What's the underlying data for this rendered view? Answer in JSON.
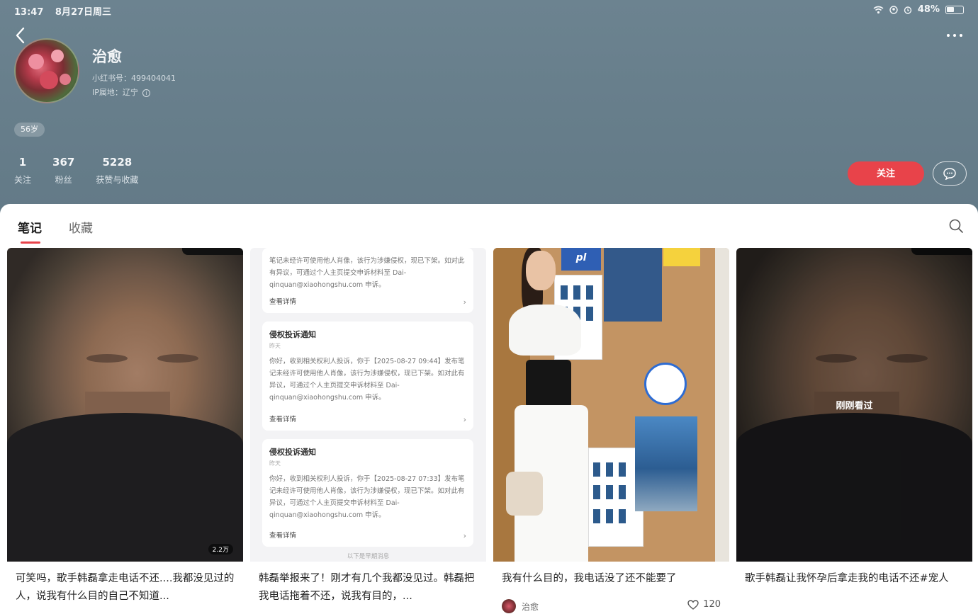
{
  "status_bar": {
    "time": "13:47",
    "date": "8月27日周三",
    "battery": "48%"
  },
  "profile": {
    "name": "治愈",
    "id_line": "小红书号：499404041",
    "ip_line": "IP属地：辽宁",
    "age_tag": "56岁",
    "stats": [
      {
        "num": "1",
        "label": "关注"
      },
      {
        "num": "367",
        "label": "粉丝"
      },
      {
        "num": "5228",
        "label": "获赞与收藏"
      }
    ],
    "follow_label": "关注"
  },
  "tabs": [
    {
      "label": "笔记",
      "active": true
    },
    {
      "label": "收藏",
      "active": false
    }
  ],
  "cards": [
    {
      "title": "可笑吗，歌手韩磊拿走电话不还....我都没见过的人，说我有什么目的自己不知道...",
      "badge": "2.2万"
    },
    {
      "title": "韩磊举报来了！刚才有几个我都没见过。韩磊把我电话拖着不还，说我有目的，...",
      "notices": [
        {
          "title": "",
          "sub": "",
          "body": "笔记未经许可使用他人肖像，该行为涉嫌侵权，现已下架。如对此有异议，可通过个人主页提交申诉材料至 Dai-qinquan@xiaohongshu.com 申诉。",
          "link": "查看详情"
        },
        {
          "title": "侵权投诉通知",
          "sub": "昨天",
          "body": "你好，收到相关权利人投诉，你于【2025-08-27 09:44】发布笔记未经许可使用他人肖像，该行为涉嫌侵权，现已下架。如对此有异议，可通过个人主页提交申诉材料至 Dai-qinquan@xiaohongshu.com 申诉。",
          "link": "查看详情"
        },
        {
          "title": "侵权投诉通知",
          "sub": "昨天",
          "body": "你好，收到相关权利人投诉，你于【2025-08-27 07:33】发布笔记未经许可使用他人肖像，该行为涉嫌侵权，现已下架。如对此有异议，可通过个人主页提交申诉材料至 Dai-qinquan@xiaohongshu.com 申诉。",
          "link": "查看详情"
        }
      ],
      "end_text": "以下是早期消息"
    },
    {
      "title": "我有什么目的，我电话没了还不能要了",
      "author": "治愈",
      "likes": "120",
      "sign": "pl"
    },
    {
      "title": "歌手韩磊让我怀孕后拿走我的电话不还#宠人",
      "overlay": "刚刚看过"
    }
  ]
}
